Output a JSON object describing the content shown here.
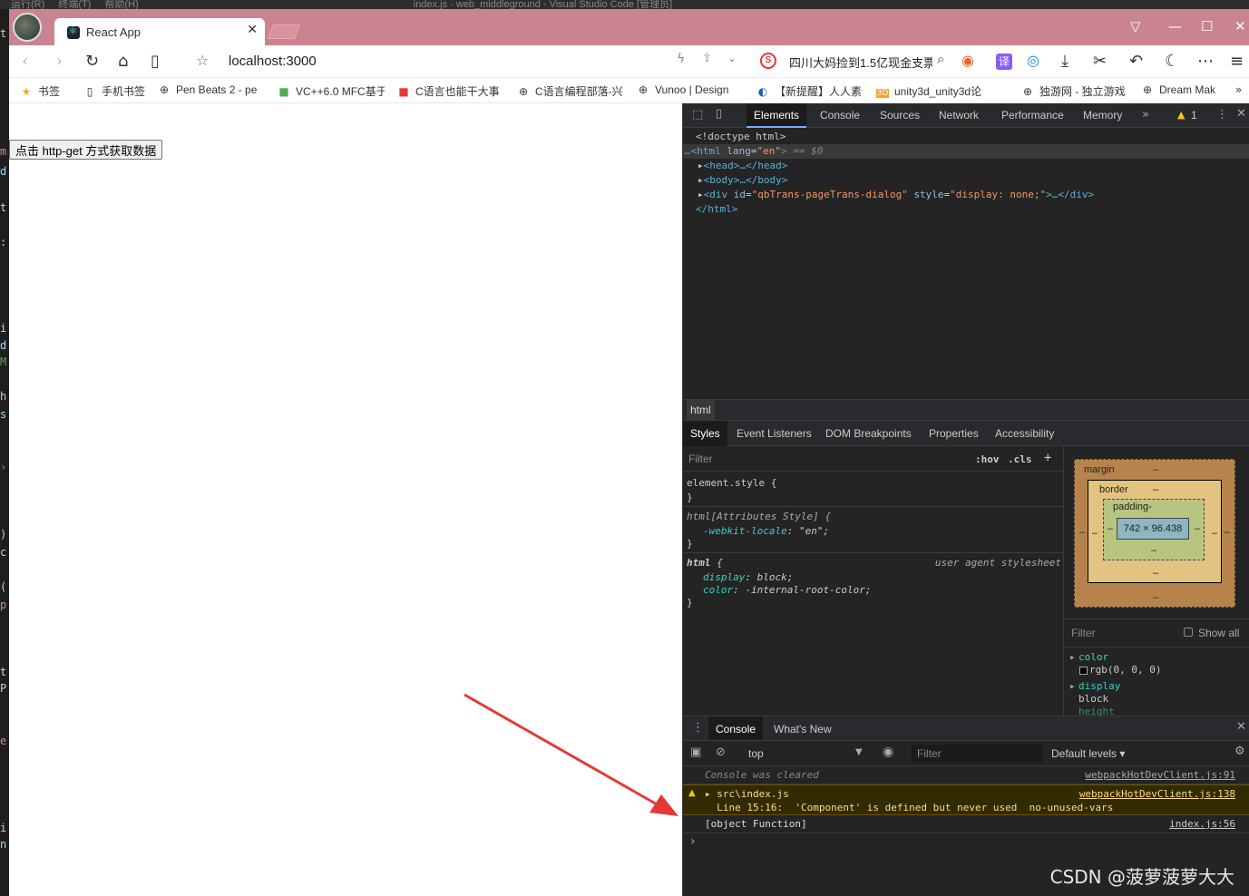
{
  "vscode": {
    "menu": [
      "运行(R)",
      "终端(T)",
      "帮助(H)"
    ],
    "window_title": "index.js - web_middleground - Visual Studio Code [管理员]"
  },
  "browser": {
    "tab_title": "React App",
    "url": "localhost:3000",
    "search_text": "四川大妈捡到1.5亿现金支票",
    "bookmarks": [
      {
        "label": "书签",
        "icon": "star-icon"
      },
      {
        "label": "手机书签",
        "icon": "phone-icon"
      },
      {
        "label": "Pen Beats 2 - pe",
        "icon": "globe-icon"
      },
      {
        "label": "VC++6.0 MFC基于",
        "icon": "site-icon"
      },
      {
        "label": "C语言也能干大事",
        "icon": "book-icon"
      },
      {
        "label": "C语言编程部落-兴",
        "icon": "globe-icon"
      },
      {
        "label": "Vunoo | Design",
        "icon": "globe-icon"
      },
      {
        "label": "【新提醒】人人素",
        "icon": "site-icon"
      },
      {
        "label": "unity3d_unity3d论",
        "icon": "3d-icon"
      },
      {
        "label": "独游网 - 独立游戏",
        "icon": "globe-icon"
      },
      {
        "label": "Dream Mak",
        "icon": "globe-icon"
      }
    ]
  },
  "page": {
    "button_label": "点击 http-get 方式获取数据"
  },
  "devtools": {
    "tabs": [
      "Elements",
      "Console",
      "Sources",
      "Network",
      "Performance",
      "Memory"
    ],
    "warning_count": "1",
    "dom": {
      "doctype": "<!doctype html>",
      "html_open_tag": "<html",
      "html_attr": "lang",
      "html_attr_val": "\"en\"",
      "html_suffix": "> == $0",
      "head": "<head>…</head>",
      "body": "<body>…</body>",
      "div_open": "<div",
      "div_attr1": "id",
      "div_val1": "\"qbTrans-pageTrans-dialog\"",
      "div_attr2": "style",
      "div_val2": "\"display: none;\"",
      "div_close": ">…</div>",
      "html_close": "</html>"
    },
    "breadcrumb": "html",
    "sub_tabs": [
      "Styles",
      "Event Listeners",
      "DOM Breakpoints",
      "Properties",
      "Accessibility"
    ],
    "styles": {
      "filter_placeholder": "Filter",
      "hov": ":hov",
      "cls": ".cls",
      "plus": "+",
      "rule1_selector": "element.style {",
      "rule_close": "}",
      "rule2_selector": "html[Attributes Style] {",
      "rule2_prop": "-webkit-locale",
      "rule2_val": ": \"en\";",
      "rule3_selector": "html",
      "rule3_brace": " {",
      "rule3_source": "user agent stylesheet",
      "rule3_prop1": "display",
      "rule3_val1": ": block;",
      "rule3_prop2": "color",
      "rule3_val2": ": -internal-root-color;"
    },
    "box_model": {
      "margin_label": "margin",
      "border_label": "border",
      "padding_label": "padding-",
      "dash": "–",
      "content_size": "742 × 96.438"
    },
    "computed": {
      "filter_placeholder": "Filter",
      "show_all": "Show all",
      "props": [
        {
          "name": "color",
          "value": "rgb(0, 0, 0)"
        },
        {
          "name": "display",
          "value": "block"
        },
        {
          "name": "height",
          "value": ""
        }
      ]
    },
    "drawer": {
      "tabs": [
        "Console",
        "What's New"
      ],
      "context": "top",
      "filter_placeholder": "Filter",
      "levels": "Default levels ▾",
      "messages": [
        {
          "text": "Console was cleared",
          "source": "webpackHotDevClient.js:91",
          "level": "info"
        },
        {
          "text": "▸ src\\index.js",
          "line2": "  Line 15:16:  'Component' is defined but never used  no-unused-vars",
          "source": "webpackHotDevClient.js:138",
          "level": "warning"
        },
        {
          "text": "[object Function]",
          "source": "index.js:56",
          "level": "log"
        }
      ],
      "prompt": "›"
    }
  },
  "watermark": "CSDN @菠萝菠萝大大",
  "colors": {
    "tabbar": "#c9848f",
    "devtools_bg": "#242424",
    "arrow": "#e53935"
  }
}
